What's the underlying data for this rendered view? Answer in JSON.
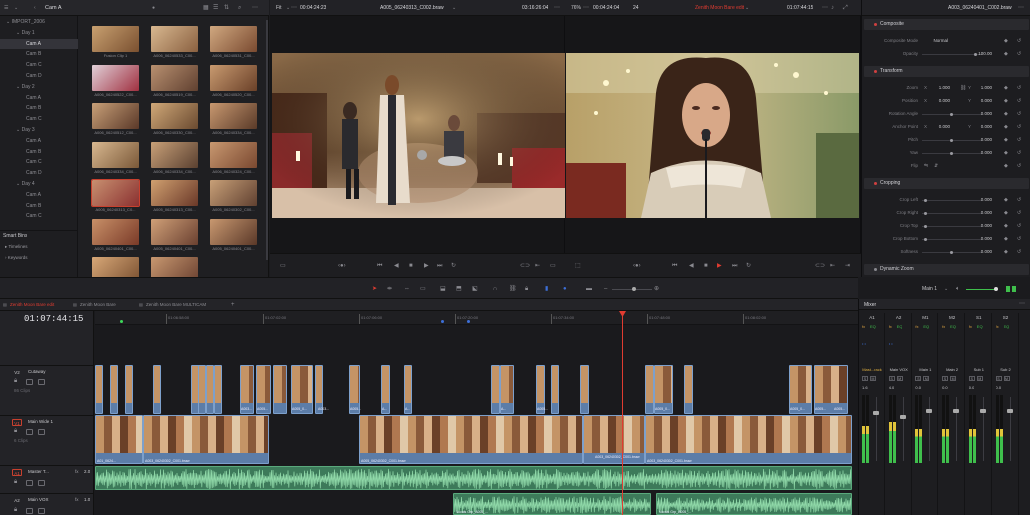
{
  "media_pool": {
    "bin_title": "Cam A",
    "tree": [
      {
        "label": "IMPORT_2006",
        "indent": 0,
        "sel": false
      },
      {
        "label": "Day 1",
        "indent": 1,
        "sel": false
      },
      {
        "label": "Cam A",
        "indent": 2,
        "sel": true
      },
      {
        "label": "Cam B",
        "indent": 2,
        "sel": false
      },
      {
        "label": "Cam C",
        "indent": 2,
        "sel": false
      },
      {
        "label": "Cam D",
        "indent": 2,
        "sel": false
      },
      {
        "label": "Day 2",
        "indent": 1,
        "sel": false
      },
      {
        "label": "Cam A",
        "indent": 2,
        "sel": false
      },
      {
        "label": "Cam B",
        "indent": 2,
        "sel": false
      },
      {
        "label": "Cam C",
        "indent": 2,
        "sel": false
      },
      {
        "label": "Day 3",
        "indent": 1,
        "sel": false
      },
      {
        "label": "Cam A",
        "indent": 2,
        "sel": false
      },
      {
        "label": "Cam B",
        "indent": 2,
        "sel": false
      },
      {
        "label": "Cam C",
        "indent": 2,
        "sel": false
      },
      {
        "label": "Cam D",
        "indent": 2,
        "sel": false
      },
      {
        "label": "Day 4",
        "indent": 1,
        "sel": false
      },
      {
        "label": "Cam A",
        "indent": 2,
        "sel": false
      },
      {
        "label": "Cam B",
        "indent": 2,
        "sel": false
      },
      {
        "label": "Cam C",
        "indent": 2,
        "sel": false
      }
    ],
    "smart_bins": {
      "title": "Smart Bins",
      "items": [
        "Timelines",
        "Keywords"
      ]
    },
    "thumbs": [
      {
        "cap": "Fusion Clip 1",
        "c1": "#c8a070",
        "c2": "#7a5030",
        "sel": false
      },
      {
        "cap": "A006_06240533_C00...",
        "c1": "#d8b890",
        "c2": "#8a6040",
        "sel": false
      },
      {
        "cap": "A006_06240531_C00...",
        "c1": "#d0a880",
        "c2": "#7a4a30",
        "sel": false
      },
      {
        "cap": "A006_06240522_C00...",
        "c1": "#e0d0d8",
        "c2": "#a03040",
        "sel": false
      },
      {
        "cap": "A006_06240519_C00...",
        "c1": "#b89070",
        "c2": "#604030",
        "sel": false
      },
      {
        "cap": "A006_06240520_C00...",
        "c1": "#c89a70",
        "c2": "#6a4028",
        "sel": false
      },
      {
        "cap": "A006_06240512_C00...",
        "c1": "#c8a078",
        "c2": "#5a3828",
        "sel": false
      },
      {
        "cap": "A006_06240330_C00...",
        "c1": "#d0a878",
        "c2": "#6a4a30",
        "sel": false
      },
      {
        "cap": "A006_06240334_C00...",
        "c1": "#c89870",
        "c2": "#5a3a28",
        "sel": false
      },
      {
        "cap": "A006_06240334_C00...",
        "c1": "#d8b890",
        "c2": "#7a5838",
        "sel": false
      },
      {
        "cap": "A006_06240334_C00...",
        "c1": "#c8a078",
        "c2": "#5a4030",
        "sel": false
      },
      {
        "cap": "A006_06240324_C00...",
        "c1": "#c89870",
        "c2": "#7a4830",
        "sel": false
      },
      {
        "cap": "A005_06240313_C0...",
        "c1": "#c89070",
        "c2": "#8a3030",
        "sel": true
      },
      {
        "cap": "A005_06240313_C00...",
        "c1": "#d0a070",
        "c2": "#6a3828",
        "sel": false
      },
      {
        "cap": "A005_06240302_C00...",
        "c1": "#c8a078",
        "c2": "#604030",
        "sel": false
      },
      {
        "cap": "A005_06240401_C00...",
        "c1": "#c89068",
        "c2": "#7a3a28",
        "sel": false
      },
      {
        "cap": "A005_06240401_C00...",
        "c1": "#d0a078",
        "c2": "#6a4030",
        "sel": false
      },
      {
        "cap": "A005_06240401_C00...",
        "c1": "#c89870",
        "c2": "#5a3828",
        "sel": false
      },
      {
        "cap": "",
        "c1": "#d8a878",
        "c2": "#7a5030",
        "sel": false
      },
      {
        "cap": "",
        "c1": "#c89870",
        "c2": "#6a4030",
        "sel": false
      }
    ]
  },
  "source_viewer": {
    "zoom": "Fit",
    "timecode_left": "00:04:24:23",
    "clip_name": "A005_06240313_C002.braw",
    "timecode_right": "03:16:26:04"
  },
  "timeline_viewer": {
    "zoom": "76%",
    "timecode_left": "00:04:24:04",
    "fps": "24",
    "timeline_name": "Zenith Moon Bare edit",
    "timecode_right": "01:07:44:15"
  },
  "inspector": {
    "clip_name": "A003_06240401_C002.braw",
    "sections": {
      "composite": "Composite",
      "transform": "Transform",
      "cropping": "Cropping",
      "dynamic_zoom": "Dynamic Zoom"
    },
    "composite": {
      "mode_label": "Composite Mode",
      "mode_value": "Normal",
      "opacity_label": "Opacity",
      "opacity_value": "100.00"
    },
    "transform": {
      "zoom_label": "Zoom",
      "zoom_x": "1.000",
      "zoom_y": "1.000",
      "position_label": "Position",
      "position_x": "0.000",
      "position_y": "0.000",
      "rotation_label": "Rotation Angle",
      "rotation_value": "0.000",
      "anchor_label": "Anchor Point",
      "anchor_x": "0.000",
      "anchor_y": "0.000",
      "pitch_label": "Pitch",
      "pitch_value": "0.000",
      "yaw_label": "Yaw",
      "yaw_value": "0.000",
      "flip_label": "Flip",
      "x_label": "X",
      "y_label": "Y"
    },
    "cropping": [
      {
        "label": "Crop Left",
        "value": "0.000"
      },
      {
        "label": "Crop Right",
        "value": "0.000"
      },
      {
        "label": "Crop Top",
        "value": "0.000"
      },
      {
        "label": "Crop Bottom",
        "value": "0.000"
      },
      {
        "label": "Softness",
        "value": "0.000"
      }
    ]
  },
  "timeline": {
    "tabs": [
      "Zenith Moon Bare edit",
      "Zenith Moon Bare",
      "Zenith Moon Bare MULTICAM"
    ],
    "timecode": "01:07:44:15",
    "ruler": [
      "01:06:58:00",
      "01:07:02:00",
      "01:07:06:00",
      "01:07:20:00",
      "01:07:34:00",
      "01:07:48:00",
      "01:08:02:00"
    ],
    "tracks": {
      "v2": {
        "id": "V2",
        "name": "Cutaway",
        "count": "86 Clips"
      },
      "v1": {
        "id": "V1",
        "name": "Main Wide 1",
        "count": "6 Clips"
      },
      "a1": {
        "id": "A1",
        "name": "Master T...",
        "fx": "fx",
        "level": "2.0"
      },
      "a2": {
        "id": "A2",
        "name": "Main VOX",
        "fx": "fx",
        "level": "1.0"
      }
    },
    "v2_labels": [
      "A003...",
      "A005...",
      "A005_0...",
      "A003...",
      "A005...",
      "A...",
      "A...",
      "A...",
      "A005...",
      "A005_0...",
      "A005_0...",
      "A005...",
      "A005..."
    ],
    "v1_labels": [
      "A01_0624...",
      "A003_06240302_C001.braw",
      "A003_06240302_C001.braw",
      "A005_06240302_C001.braw",
      "A003_06240302_C001.braw"
    ],
    "a2_labels": [
      "Vocals Grp_A005_...",
      "Vocals Grp_A005_..."
    ]
  },
  "mixer": {
    "title": "Mixer",
    "channels": [
      {
        "id": "A1",
        "eq": "EQ",
        "name": "Mast...rack",
        "level": "1.6",
        "meter": 0.55,
        "fader": 0.78
      },
      {
        "id": "A2",
        "eq": "EQ",
        "name": "Main VOX",
        "level": "4.0",
        "meter": 0.6,
        "fader": 0.72
      },
      {
        "id": "M1",
        "eq": "EQ",
        "name": "Main 1",
        "level": "0.0",
        "meter": 0.5,
        "fader": 0.82
      },
      {
        "id": "M2",
        "eq": "EQ",
        "name": "Main 2",
        "level": "0.0",
        "meter": 0.5,
        "fader": 0.82
      },
      {
        "id": "S1",
        "eq": "EQ",
        "name": "Sub 1",
        "level": "0.0",
        "meter": 0.5,
        "fader": 0.82
      },
      {
        "id": "S2",
        "eq": "EQ",
        "name": "Sub 2",
        "level": "0.0",
        "meter": 0.5,
        "fader": 0.82
      }
    ],
    "main_output": "Main 1"
  },
  "colors": {
    "accent_red": "#e03c31",
    "clip_blue": "#5c7da8",
    "clip_green": "#3d7a5a",
    "bg": "#1b1b1e"
  }
}
